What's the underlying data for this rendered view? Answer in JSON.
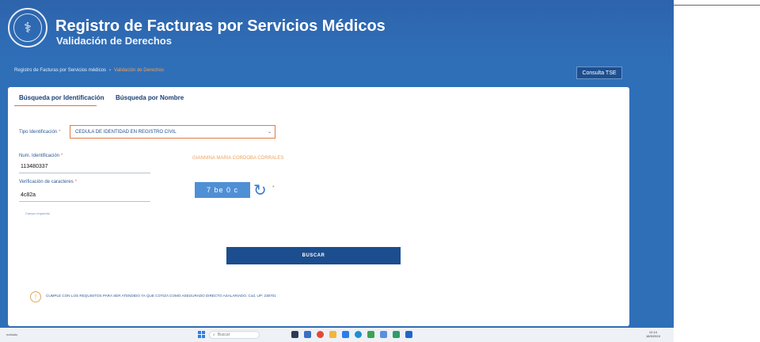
{
  "header": {
    "title": "Registro de Facturas por Servicios Médicos",
    "subtitle": "Validación de Derechos",
    "logo_icon": "seguro-social-seal"
  },
  "breadcrumb": {
    "root": "Registro de Facturas por Servicios médicos",
    "separator": "›",
    "current": "Validación de Derechos"
  },
  "consulta_button": "Consulta TSE",
  "tabs": [
    {
      "label": "Búsqueda por Identificación",
      "active": true
    },
    {
      "label": "Búsqueda por Nombre",
      "active": false
    }
  ],
  "form": {
    "tipo_label": "Tipo Identificación",
    "tipo_value": "CEDULA DE IDENTIDAD EN REGISTRO CIVIL",
    "num_label": "Num. Identificación",
    "num_value": "113480337",
    "verif_label": "Verificación de caracteres",
    "verif_value": "4c82a",
    "required_mark": "*",
    "required_note": "Campo requerido",
    "person_name": "GIANNINA MARIA CORDOBA CORRALES",
    "captcha_text": "7 be 0 c",
    "search_button": "BUSCAR"
  },
  "notice": "CUMPLE CON LOS REQUISITOS PARA SER ATENDIDO YA QUE COTIZA COMO ASEGURADO DIRECTO ASALARIADO. Cod. UP: 238701",
  "taskbar": {
    "search_placeholder": "Buscar",
    "left_text": "nublado",
    "time": "12:14",
    "date": "18/3/2024"
  },
  "colors": {
    "brand_blue": "#2f6fb8",
    "accent_orange": "#e8702f",
    "button_blue": "#1c4d8e"
  }
}
